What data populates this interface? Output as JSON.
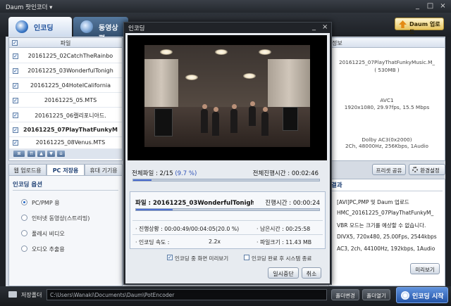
{
  "app": {
    "title": "Daum 팟인코더 ▾"
  },
  "tabs": [
    {
      "label": "인코딩"
    },
    {
      "label": "동영상 편"
    }
  ],
  "upload_button": "Daum 업로드",
  "file_list": {
    "header": "파일",
    "files": [
      "20161225_02CatchTheRainbo",
      "20161225_03WonderfulTonigh",
      "20161225_04HotelCalifornia",
      "20161225_05.MTS",
      "20161225_06캘리포니아드.",
      "20161225_07PlayThatFunkyM",
      "20161225_08Venus.MTS"
    ]
  },
  "left_tabs": [
    "웹 업로드용",
    "PC 저장용",
    "휴대 기기용"
  ],
  "encode_options": {
    "title": "인코딩 옵션",
    "items": [
      "PC/PMP 용",
      "인터넷 동영상(스트리밍)",
      "풀레시 비디오",
      "오디오 추출용"
    ]
  },
  "info_panel": {
    "header": "정보",
    "file": "20161225_07PlayThatFunkyMusic.M_",
    "size": "( 530MB )",
    "video": "AVC1",
    "video_detail": "1920x1080, 29.97fps, 15.5 Mbps",
    "audio": "Dolby AC3(0x2000)",
    "audio_detail": "2Ch, 48000Hz, 256Kbps, 1Audio"
  },
  "right_buttons": [
    "프리셋 공유",
    "환경설정"
  ],
  "result": {
    "title": "결과",
    "lines": [
      "[AVI]PC,PMP 및 Daum 업로드",
      "HMC_20161225_07PlayThatFunkyM_",
      "VBR 모드는 크기를 예상할 수 없습니다.",
      "DIVX5, 720x480, 25.00Fps, 2544kbps",
      "AC3, 2ch, 44100Hz, 192kbps, 1Audio"
    ],
    "preview_button": "미리보기"
  },
  "bottom": {
    "save_folder_label": "저장폴더",
    "path": "C:\\Users\\Wanaki\\Documents\\Daum\\PotEncoder",
    "change_button": "폴더변경",
    "open_button": "폴더열기",
    "start_button": "인코딩 시작"
  },
  "dialog": {
    "title": "인코딩",
    "total_label": "전체파일 : 2/15",
    "total_percent": "(9.7 %)",
    "total_time": "전체진행시간 :  00:02:46",
    "total_progress": 0.097,
    "file_label": "파일 : 20161225_03WonderfulTonigh...",
    "file_time": "진행시간 :  00:00:24",
    "file_progress": 0.2,
    "status": "· 진행상황 :  00:00:49/00:04:05(20.0 %)",
    "remaining": "· 남은시간 :  00:25:58",
    "speed_label": "· 인코딩 속도 :",
    "speed": "2.2x",
    "filesize": "· 파일크기 :  11.43 MB",
    "opt_preview": "인코딩 중 화면 미리보기",
    "opt_shutdown": "인코딩 완료 후 시스템 종료",
    "pause_button": "일시중단",
    "cancel_button": "취소"
  }
}
